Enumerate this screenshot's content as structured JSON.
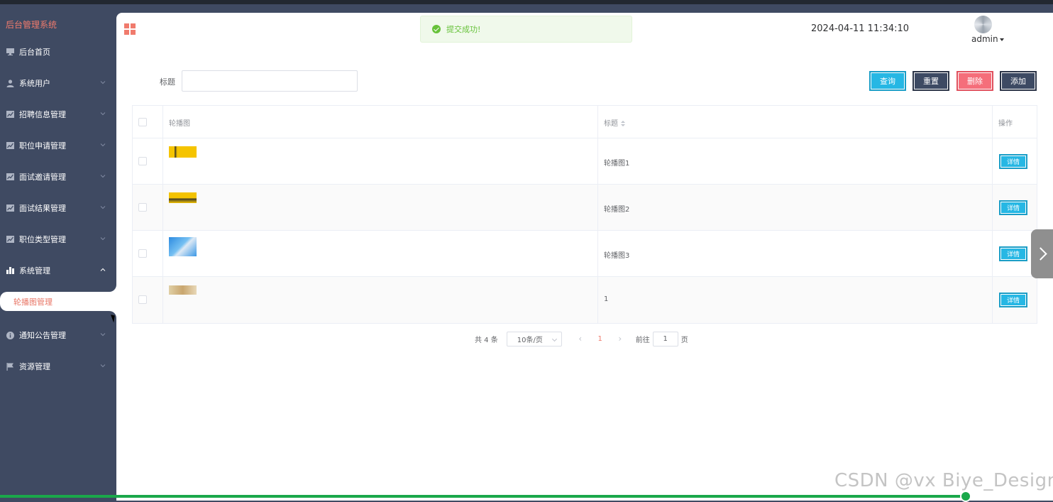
{
  "sidebar": {
    "brand": "后台管理系统",
    "items": [
      {
        "label": "后台首页",
        "icon": "monitor-icon"
      },
      {
        "label": "系统用户",
        "icon": "user-icon"
      },
      {
        "label": "招聘信息管理",
        "icon": "chart-icon"
      },
      {
        "label": "职位申请管理",
        "icon": "chart-icon"
      },
      {
        "label": "面试邀请管理",
        "icon": "chart-icon"
      },
      {
        "label": "面试结果管理",
        "icon": "chart-icon"
      },
      {
        "label": "职位类型管理",
        "icon": "chart-icon"
      },
      {
        "label": "系统管理",
        "icon": "bar-chart-icon"
      },
      {
        "label": "通知公告管理",
        "icon": "info-icon"
      },
      {
        "label": "资源管理",
        "icon": "flag-icon"
      }
    ],
    "active_submenu": "轮播图管理"
  },
  "header": {
    "toast": "提交成功!",
    "datetime": "2024-04-11 11:34:10",
    "user": "admin"
  },
  "search": {
    "label": "标题",
    "value": "",
    "placeholder": ""
  },
  "buttons": {
    "query": "查询",
    "reset": "重置",
    "delete": "删除",
    "add": "添加"
  },
  "table": {
    "columns": [
      "轮播图",
      "标题",
      "操作"
    ],
    "rows": [
      {
        "title": "轮播图1",
        "action": "详情"
      },
      {
        "title": "轮播图2",
        "action": "详情"
      },
      {
        "title": "轮播图3",
        "action": "详情"
      },
      {
        "title": "1",
        "action": "详情"
      }
    ]
  },
  "pagination": {
    "total": "共 4 条",
    "page_size": "10条/页",
    "current_page": "1",
    "goto_label": "前往",
    "goto_value": "1",
    "page_suffix": "页"
  },
  "video": {
    "progress": 0.917
  },
  "watermark": "CSDN @vx  Biye_Design",
  "colors": {
    "sidebar": "#3f4a62",
    "accent": "#f07b6d",
    "primary": "#26b7e4",
    "danger": "#f56e7a",
    "success": "#67c23a"
  }
}
